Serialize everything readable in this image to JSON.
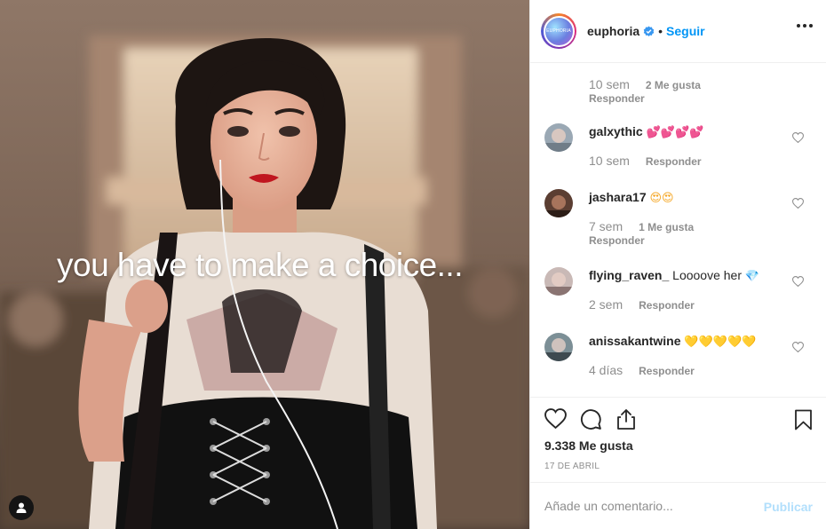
{
  "media": {
    "overlay_text": "you have to make a choice..."
  },
  "header": {
    "username": "euphoria",
    "avatar_text": "EUPHORIA",
    "separator": "•",
    "follow_label": "Seguir"
  },
  "comments": {
    "reply_block": {
      "time": "10 sem",
      "likes": "2 Me gusta",
      "reply": "Responder"
    },
    "items": [
      {
        "user": "galxythic",
        "text": "",
        "emoji": "💕💕💕💕",
        "time": "10 sem",
        "likes": "",
        "reply": "Responder"
      },
      {
        "user": "jashara17",
        "text": "",
        "emoji": "😍😍",
        "time": "7 sem",
        "likes": "1 Me gusta",
        "reply": "Responder"
      },
      {
        "user": "flying_raven_",
        "text": "Loooove her",
        "emoji": "💎",
        "time": "2 sem",
        "likes": "",
        "reply": "Responder"
      },
      {
        "user": "anissakantwine",
        "text": "",
        "emoji": "💛💛💛💛💛",
        "time": "4 días",
        "likes": "",
        "reply": "Responder"
      }
    ]
  },
  "footer": {
    "likes": "9.338 Me gusta",
    "date": "17 DE ABRIL",
    "comment_placeholder": "Añade un comentario...",
    "publish_label": "Publicar"
  },
  "colors": {
    "link_blue": "#0095f6",
    "publish_disabled": "#b2dffc",
    "muted": "#8e8e8e",
    "text": "#262626",
    "emoji_pink": "#f0609a",
    "emoji_yellow": "#f5c73a"
  },
  "icons": [
    "verified-badge-icon",
    "more-options-icon",
    "heart-icon",
    "comment-icon",
    "share-icon",
    "bookmark-icon",
    "user-tag-icon"
  ]
}
